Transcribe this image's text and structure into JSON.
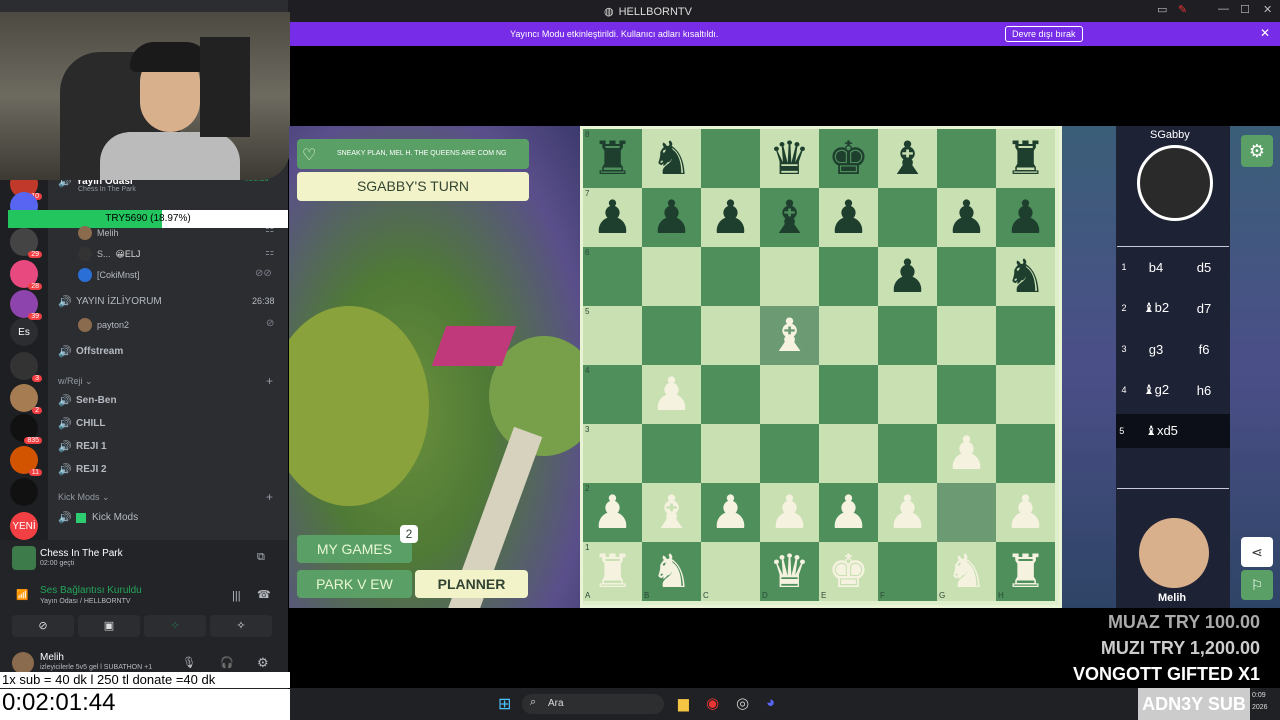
{
  "window": {
    "title": "HELLBORNTV"
  },
  "banner": {
    "message": "Yayıncı Modu etkinleştirildi. Kullanıcı adları kısaltıldı.",
    "button": "Devre dışı bırak"
  },
  "discord": {
    "voice_room": {
      "name": "Yayın Odası",
      "time": "4:55:10",
      "activity": "Chess In The Park"
    },
    "progress": {
      "label": "TRY5690 (18.97%)",
      "fraction": 0.1897
    },
    "users_a": [
      {
        "name": "Melih"
      },
      {
        "name": "S...",
        "tag": "😀ELJ"
      },
      {
        "name": "[CokiMnst]"
      }
    ],
    "channels": [
      {
        "name": "YAYIN İZLİYORUM",
        "time": "26:38",
        "kind": "voice"
      },
      {
        "name": "Offstream",
        "kind": "voice"
      }
    ],
    "payton": {
      "name": "payton2"
    },
    "category": {
      "name": "w/Reji"
    },
    "voice_channels": [
      "Sen-Ben",
      "CHILL",
      "REJI 1",
      "REJI 2"
    ],
    "category2": {
      "name": "Kick Mods"
    },
    "kick_channel": "Kick Mods",
    "servers": [
      {
        "badge": "10",
        "color": "#c0392b"
      },
      {
        "badge": "",
        "color": "#5865f2"
      },
      {
        "badge": "29",
        "color": "#444"
      },
      {
        "badge": "28",
        "color": "#e84a7f"
      },
      {
        "badge": "39",
        "color": "#8e44ad"
      },
      {
        "badge": "",
        "color": "#2b2d31",
        "text": "Es"
      },
      {
        "badge": "3",
        "color": "#333"
      },
      {
        "badge": "2",
        "color": "#a67c52"
      },
      {
        "badge": "835",
        "color": "#111"
      },
      {
        "badge": "11",
        "color": "#d35400"
      },
      {
        "badge": "",
        "color": "#111"
      },
      {
        "badge": "",
        "color": "#f23f43",
        "text": "YENİ"
      }
    ],
    "activity_card": {
      "title": "Chess In The Park",
      "sub": "02:00 geçti"
    },
    "connection": {
      "status": "Ses Bağlantısı Kuruldu",
      "where": "Yayın Odası / HELLBORNTV"
    },
    "me": {
      "name": "Melih",
      "status": "izleyicilerle 5v5 gel l SUBATHON +1"
    }
  },
  "overlay": {
    "subline": "1x sub = 40 dk l 250 tl donate =40 dk",
    "timer": "0:02:01:44"
  },
  "game": {
    "notice": "SNEAKY PLAN, MEL H. THE QUEENS ARE COM NG",
    "turn": "SGABBY'S TURN",
    "my_games": "MY GAMES",
    "my_games_count": "2",
    "park_view": "PARK V EW",
    "planner": "PLANNER",
    "opponent": "SGabby",
    "me": "Melih",
    "moves": [
      {
        "n": "1",
        "w": "b4",
        "b": "d5"
      },
      {
        "n": "2",
        "w": "♝b2",
        "b": "d7"
      },
      {
        "n": "3",
        "w": "g3",
        "b": "f6"
      },
      {
        "n": "4",
        "w": "♝g2",
        "b": "h6"
      },
      {
        "n": "5",
        "w": "♝xd5",
        "b": ""
      }
    ],
    "board_rows": [
      [
        "br",
        "bn",
        "",
        "bq",
        "bk",
        "bb",
        "",
        "br"
      ],
      [
        "bp",
        "bp",
        "bp",
        "bb",
        "bp",
        "",
        "bp",
        "bp"
      ],
      [
        "",
        "",
        "",
        "",
        "",
        "bp",
        "",
        "bn"
      ],
      [
        "",
        "",
        "",
        "wb",
        "",
        "",
        "",
        ""
      ],
      [
        "",
        "wp",
        "",
        "",
        "",
        "",
        "",
        ""
      ],
      [
        "",
        "",
        "",
        "",
        "",
        "",
        "wp",
        ""
      ],
      [
        "wp",
        "wb",
        "wp",
        "wp",
        "wp",
        "wp",
        "",
        "wp"
      ],
      [
        "wr",
        "wn",
        "",
        "wq",
        "wk",
        "",
        "wn",
        "wr"
      ]
    ],
    "ranks": [
      "8",
      "7",
      "6",
      "5",
      "4",
      "3",
      "2",
      "1"
    ],
    "files": [
      "A",
      "B",
      "C",
      "D",
      "E",
      "F",
      "G",
      "H"
    ]
  },
  "alerts": [
    {
      "text": "MUAZ  TRY 100.00",
      "color": "#aaaaaa"
    },
    {
      "text": "MUZI  TRY 1,200.00",
      "color": "#cccccc"
    },
    {
      "text": "VONGOTT  GIFTED X1",
      "color": "#ffffff"
    },
    {
      "text": "ADN3Y  SUB",
      "color": "#ffffff"
    }
  ],
  "taskbar": {
    "search": "Ara",
    "time": "0:09",
    "date": "2026"
  }
}
